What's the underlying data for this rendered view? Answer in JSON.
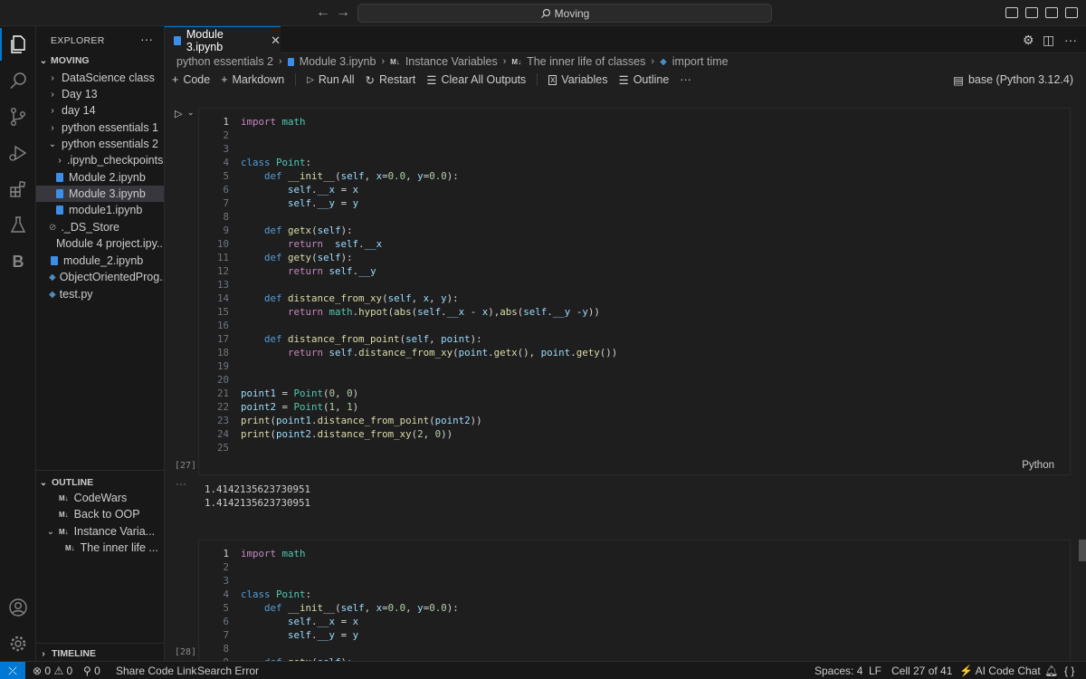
{
  "titlebar": {
    "search_text": "Moving"
  },
  "explorer": {
    "title": "EXPLORER",
    "root": "MOVING",
    "items": [
      {
        "label": "DataScience class"
      },
      {
        "label": "Day 13"
      },
      {
        "label": "day 14"
      },
      {
        "label": "python essentials 1"
      },
      {
        "label": "python essentials 2"
      },
      {
        "label": ".ipynb_checkpoints"
      },
      {
        "label": "Module 2.ipynb"
      },
      {
        "label": "Module 3.ipynb"
      },
      {
        "label": "module1.ipynb"
      },
      {
        "label": "._DS_Store"
      },
      {
        "label": "Module 4 project.ipy..."
      },
      {
        "label": "module_2.ipynb"
      },
      {
        "label": "ObjectOrientedProg..."
      },
      {
        "label": "test.py"
      }
    ]
  },
  "outline": {
    "title": "OUTLINE",
    "items": [
      {
        "label": "CodeWars"
      },
      {
        "label": "Back to OOP"
      },
      {
        "label": "Instance Varia..."
      },
      {
        "label": "The inner life ..."
      }
    ]
  },
  "timeline": {
    "title": "TIMELINE"
  },
  "tab": {
    "label": "Module 3.ipynb"
  },
  "breadcrumb": [
    "python essentials 2",
    "Module 3.ipynb",
    "Instance Variables",
    "The inner life of classes",
    "import time"
  ],
  "md_badge": "M↓",
  "toolbar": {
    "code": "Code",
    "markdown": "Markdown",
    "run_all": "Run All",
    "restart": "Restart",
    "clear_outputs": "Clear All Outputs",
    "variables": "Variables",
    "outline": "Outline",
    "kernel": "base (Python 3.12.4)"
  },
  "cell1": {
    "exec_count": "[27]",
    "language": "Python",
    "output": [
      "1.4142135623730951",
      "1.4142135623730951"
    ]
  },
  "cell2": {
    "exec_count": "[28]"
  },
  "statusbar": {
    "errors": "0",
    "warnings": "0",
    "ports": "0",
    "share": "Share Code Link",
    "search_error": "Search Error",
    "spaces": "Spaces: 4",
    "eol": "LF",
    "cell_pos": "Cell 27 of 41",
    "ai_chat": "AI Code Chat"
  },
  "colors": {
    "accent": "#0078d4",
    "background": "#1f1f1f"
  }
}
